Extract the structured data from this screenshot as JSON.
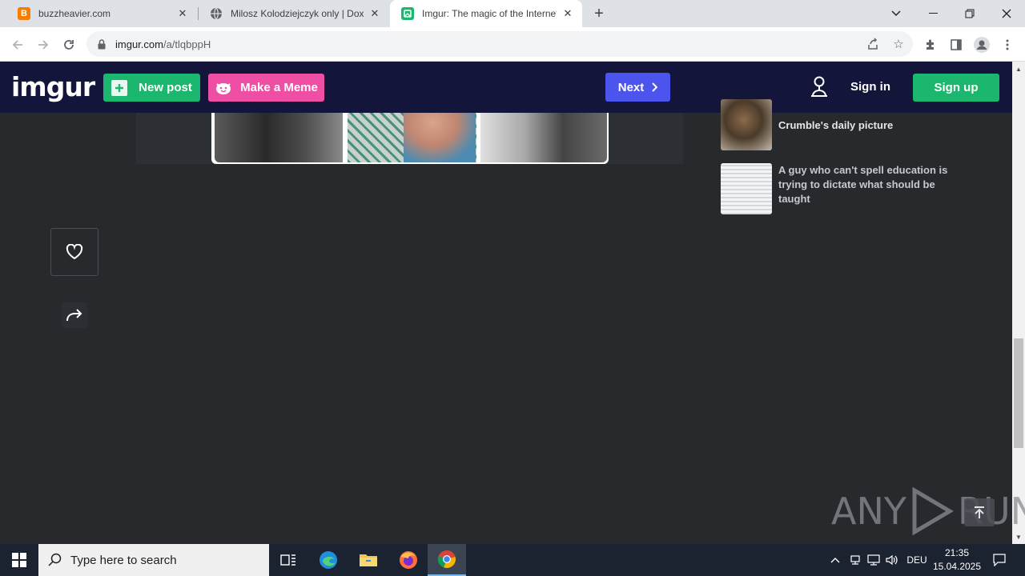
{
  "browser": {
    "tabs": [
      {
        "title": "buzzheavier.com",
        "favicon": "blogger-b-icon",
        "active": false
      },
      {
        "title": "Milosz Kolodziejczyk only | Doxbin",
        "favicon": "globe-icon",
        "active": false
      },
      {
        "title": "Imgur: The magic of the Internet",
        "favicon": "imgur-icon",
        "active": true
      }
    ],
    "url_host": "imgur.com",
    "url_path": "/a/tlqbppH"
  },
  "header": {
    "logo": "imgur",
    "new_post": "New post",
    "make_meme": "Make a Meme",
    "next": "Next",
    "sign_in": "Sign in",
    "sign_up": "Sign up"
  },
  "sidebar": {
    "items": [
      {
        "title": "Crumble's daily picture",
        "thumb": "cat-photo"
      },
      {
        "title": "A guy who can't spell education is trying to dictate what should be taught",
        "thumb": "text-screenshot"
      }
    ]
  },
  "watermark": {
    "left": "ANY",
    "right": "RUN"
  },
  "taskbar": {
    "search_placeholder": "Type here to search",
    "language": "DEU",
    "time": "21:35",
    "date": "15.04.2025"
  },
  "colors": {
    "imgur_header": "#13153a",
    "page_bg": "#27292d",
    "green": "#1bb76e",
    "pink": "#ee4fa5",
    "next_blue": "#4b55ee"
  }
}
